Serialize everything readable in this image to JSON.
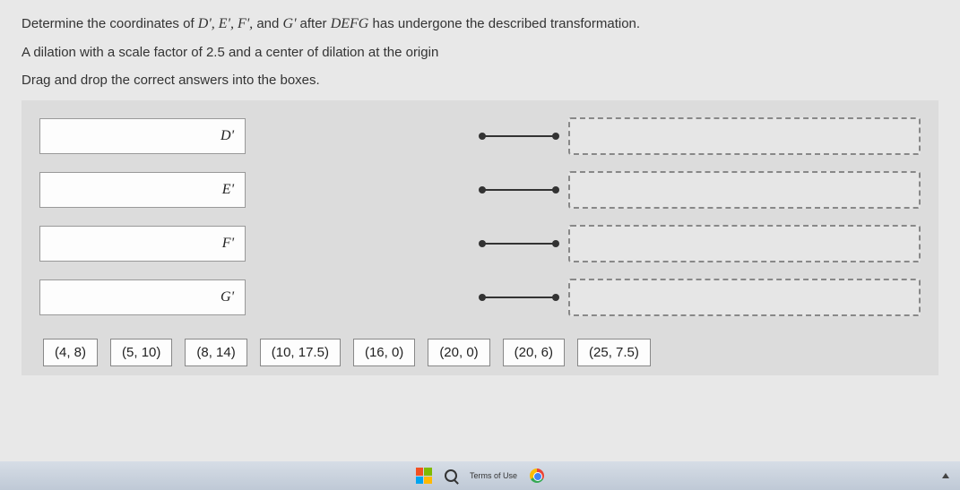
{
  "instructions": {
    "line1_pre": "Determine the coordinates of ",
    "line1_vars": "D', E', F',",
    "line1_mid": " and ",
    "line1_var2": "G' ",
    "line1_after": "after ",
    "line1_shape": "DEFG",
    "line1_end": " has undergone the described transformation.",
    "line2": "A dilation with a scale factor of 2.5 and a center of dilation at the origin",
    "line3": "Drag and drop the correct answers into the boxes."
  },
  "rows": [
    {
      "label": "D'"
    },
    {
      "label": "E'"
    },
    {
      "label": "F'"
    },
    {
      "label": "G'"
    }
  ],
  "choices": [
    "(4, 8)",
    "(5, 10)",
    "(8, 14)",
    "(10, 17.5)",
    "(16, 0)",
    "(20, 0)",
    "(20, 6)",
    "(25, 7.5)"
  ],
  "taskbar": {
    "terms": "Terms of Use"
  }
}
